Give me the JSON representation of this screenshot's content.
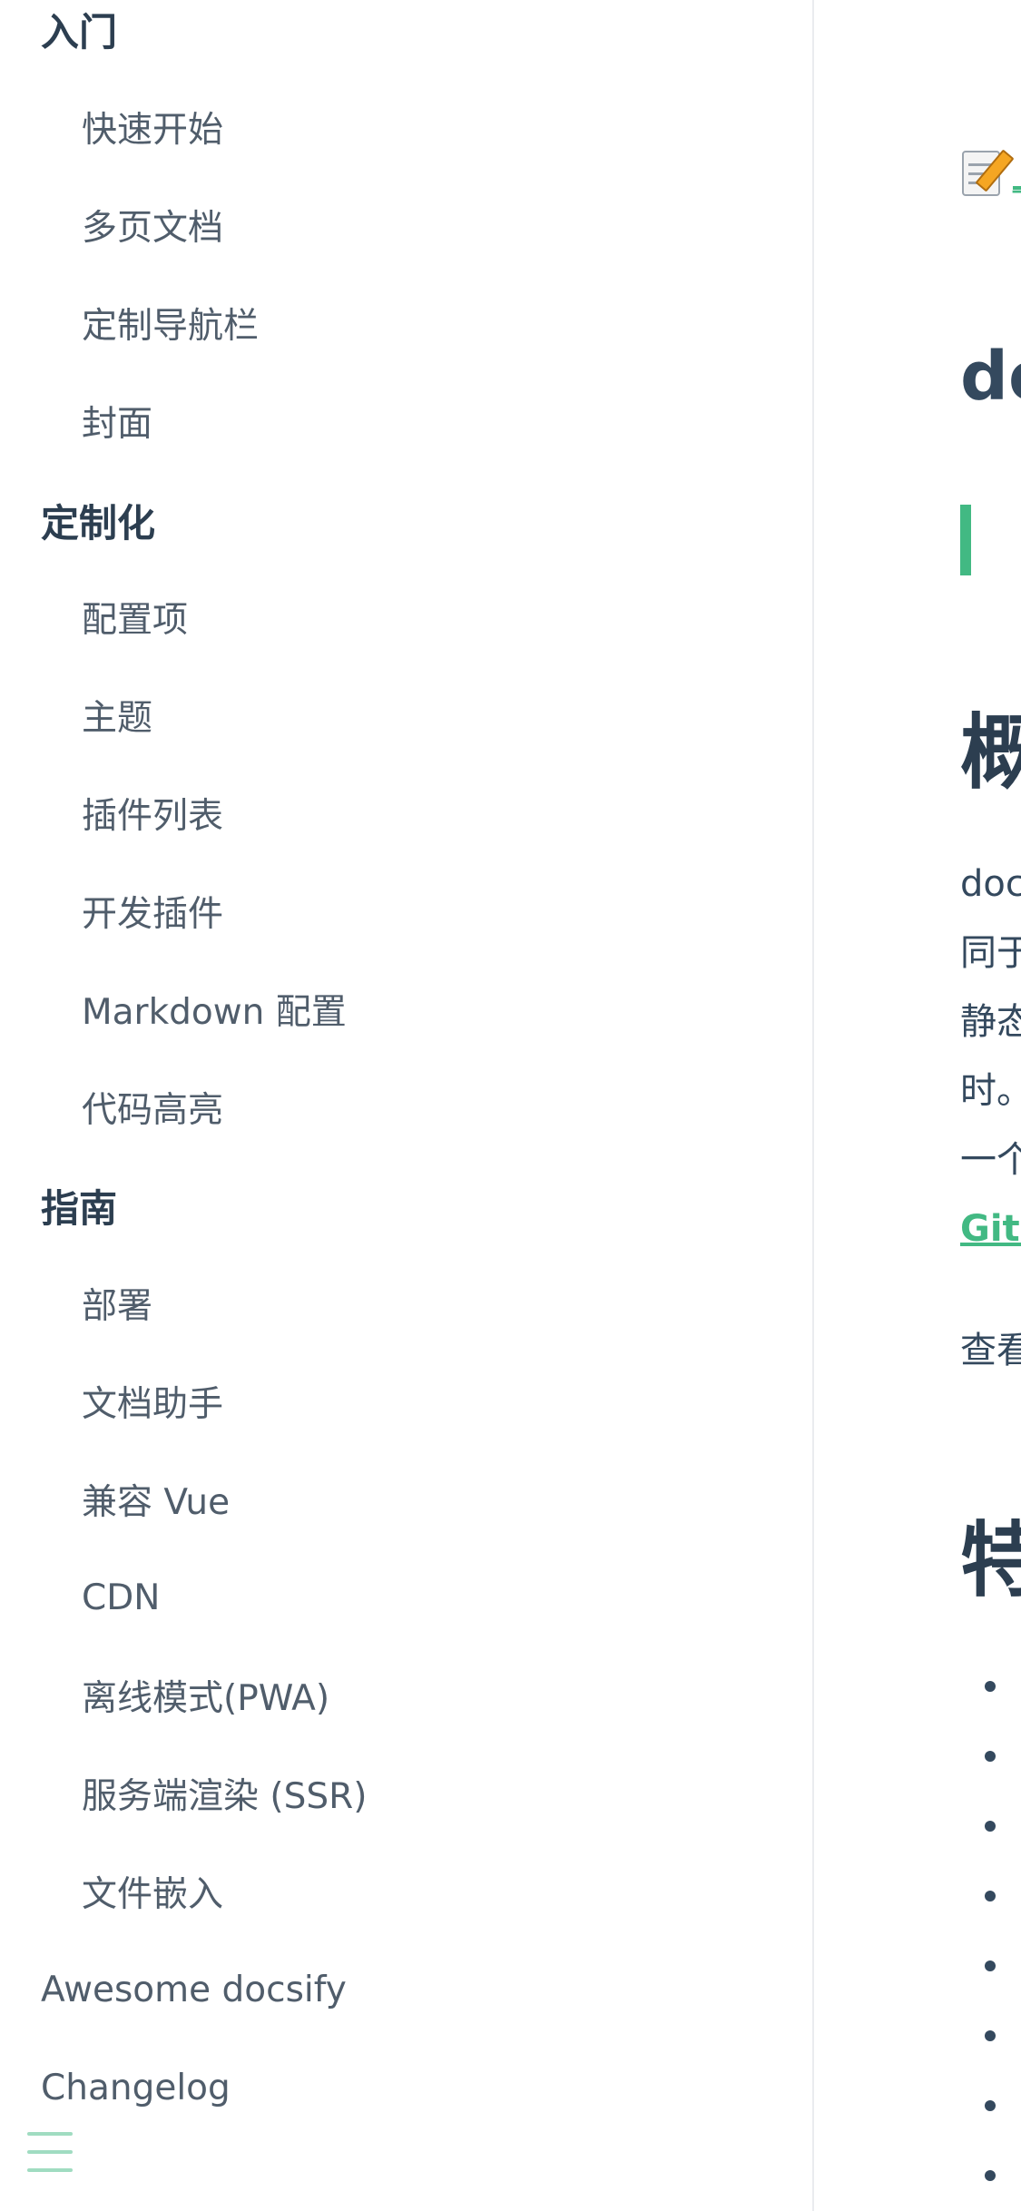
{
  "sidebar": {
    "sections": [
      {
        "title": "入门",
        "items": [
          "快速开始",
          "多页文档",
          "定制导航栏",
          "封面"
        ]
      },
      {
        "title": "定制化",
        "items": [
          "配置项",
          "主题",
          "插件列表",
          "开发插件",
          "Markdown 配置",
          "代码高亮"
        ]
      },
      {
        "title": "指南",
        "items": [
          "部署",
          "文档助手",
          "兼容 Vue",
          "CDN",
          "离线模式(PWA)",
          "服务端渲染 (SSR)",
          "文件嵌入"
        ]
      }
    ],
    "top_links": [
      "Awesome docsify",
      "Changelog"
    ],
    "menu_toggle_icon": "hamburger-menu-icon"
  },
  "content": {
    "edit_icon": "memo-pencil-icon",
    "edit_link": "_",
    "title": "do",
    "section1_title": "概",
    "paragraph_lines": [
      "doc",
      "同于",
      "静态",
      "时。",
      "一个"
    ],
    "github_link": "Gith",
    "paragraph2": "查看",
    "section2_title": "特"
  },
  "colors": {
    "accent": "#42b983",
    "text": "#34495e",
    "heading": "#2c3e50",
    "sidebar_text": "#505d6b",
    "divider": "#eaecef"
  }
}
